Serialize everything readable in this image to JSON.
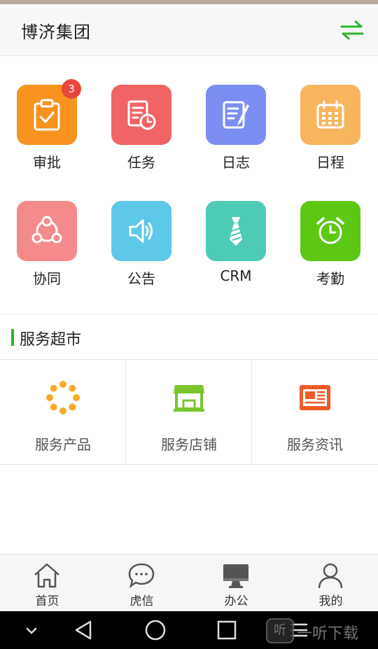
{
  "header": {
    "title": "博济集团",
    "switch_icon": "switch-arrows-icon",
    "accent": "#2db52d"
  },
  "apps": [
    {
      "label": "审批",
      "icon": "clipboard-check-icon",
      "color": "#f7931e",
      "badge": "3"
    },
    {
      "label": "任务",
      "icon": "task-clock-icon",
      "color": "#f06464"
    },
    {
      "label": "日志",
      "icon": "notepad-pen-icon",
      "color": "#7b8ff2"
    },
    {
      "label": "日程",
      "icon": "calendar-icon",
      "color": "#f7b65e"
    },
    {
      "label": "协同",
      "icon": "collaboration-icon",
      "color": "#f58a8a"
    },
    {
      "label": "公告",
      "icon": "speaker-icon",
      "color": "#5ec8e9"
    },
    {
      "label": "CRM",
      "icon": "tie-icon",
      "color": "#4dcbb5"
    },
    {
      "label": "考勤",
      "icon": "alarm-clock-icon",
      "color": "#5cc814"
    }
  ],
  "market": {
    "title": "服务超市",
    "items": [
      {
        "label": "服务产品",
        "icon": "dots-ring-icon",
        "color": "#f7a928"
      },
      {
        "label": "服务店铺",
        "icon": "storefront-icon",
        "color": "#7ac52c"
      },
      {
        "label": "服务资讯",
        "icon": "newspaper-icon",
        "color": "#ef5a28"
      }
    ]
  },
  "tabs": [
    {
      "label": "首页",
      "icon": "home-icon"
    },
    {
      "label": "虎信",
      "icon": "chat-bubble-icon"
    },
    {
      "label": "办公",
      "icon": "desktop-icon",
      "active": true
    },
    {
      "label": "我的",
      "icon": "person-icon"
    }
  ],
  "watermark": {
    "badge": "听",
    "text": "一听下载"
  }
}
